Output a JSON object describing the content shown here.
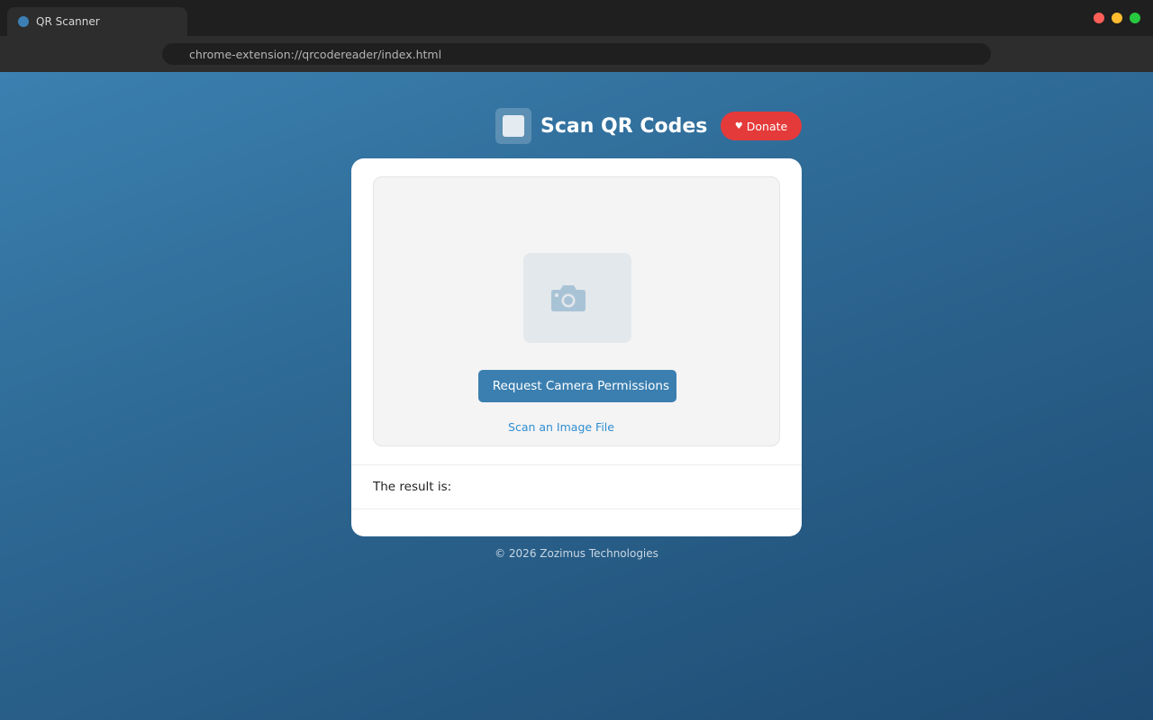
{
  "browser": {
    "tab_title": "QR Scanner",
    "url": "chrome-extension://qrcodereader/index.html",
    "window_controls": {
      "close_color": "#ff5f57",
      "minimize_color": "#febc2e",
      "maximize_color": "#28c840"
    }
  },
  "header": {
    "title": "Scan QR Codes",
    "donate_label": "Donate",
    "donate_icon": "heart-icon"
  },
  "scanner": {
    "camera_icon": "camera-icon",
    "request_button_label": "Request Camera Permissions",
    "scan_file_link": "Scan an Image File"
  },
  "result": {
    "label": "The result is:"
  },
  "footer": {
    "copyright": "© 2026 Zozimus Technologies"
  },
  "colors": {
    "accent": "#3b7fb0",
    "donate": "#e53a3a",
    "link": "#2f8ed2"
  }
}
